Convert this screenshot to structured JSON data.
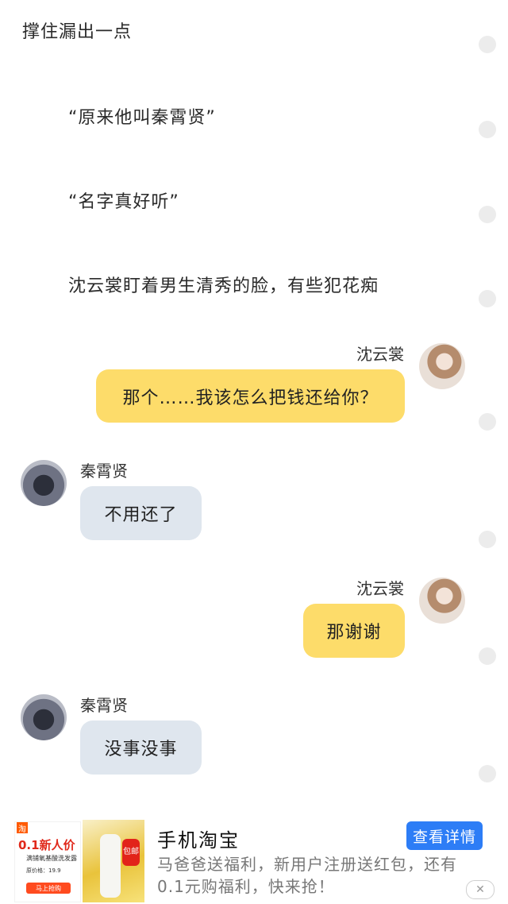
{
  "narration": [
    "撑住漏出一点",
    "“原来他叫秦霄贤”",
    "“名字真好听”",
    "沈云裳盯着男生清秀的脸，有些犯花痴"
  ],
  "messages": [
    {
      "sender": "沈云裳",
      "text": "那个……我该怎么把钱还给你？"
    },
    {
      "sender": "秦霄贤",
      "text": "不用还了"
    },
    {
      "sender": "沈云裳",
      "text": "那谢谢"
    },
    {
      "sender": "秦霄贤",
      "text": "没事没事"
    }
  ],
  "ad": {
    "thumb1": {
      "logo": "淘",
      "price": "0.1新人价",
      "line1": "满铺氧基酸洗发露",
      "line2": "原价格：19.9",
      "buy": "马上抢购"
    },
    "thumb2": {
      "badge": "包邮"
    },
    "title": "手机淘宝",
    "description": "马爸爸送福利，新用户注册送红包，还有0.1元购福利，快来抢！",
    "button": "查看详情",
    "close": "✕"
  },
  "icons": {
    "dot": "side-dot-icon",
    "close": "close-icon"
  }
}
